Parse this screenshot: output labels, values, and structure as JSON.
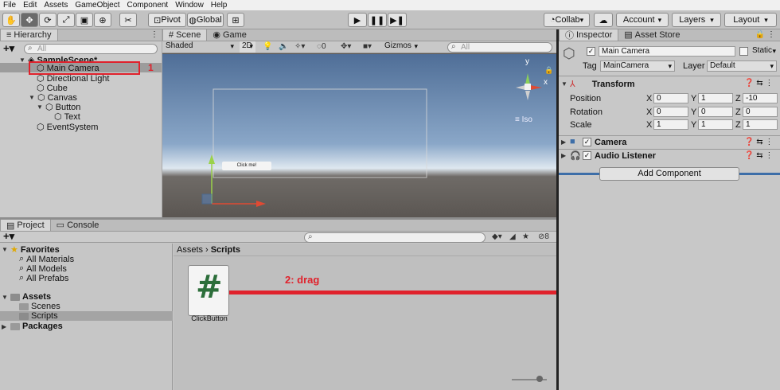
{
  "menu": [
    "File",
    "Edit",
    "Assets",
    "GameObject",
    "Component",
    "Window",
    "Help"
  ],
  "toolbar": {
    "pivot": "Pivot",
    "global": "Global",
    "collab": "Collab",
    "account": "Account",
    "layers": "Layers",
    "layout": "Layout"
  },
  "hierarchy": {
    "tab": "Hierarchy",
    "search_placeholder": "All",
    "scene": "SampleScene*",
    "items": [
      "Main Camera",
      "Directional Light",
      "Cube",
      "Canvas",
      "Button",
      "Text",
      "EventSystem"
    ]
  },
  "scene_view": {
    "tabs": [
      "Scene",
      "Game"
    ],
    "shading": "Shaded",
    "mode_2d": "2D",
    "gizmos": "Gizmos",
    "search_placeholder": "All",
    "gizmo_y": "y",
    "gizmo_x": "x",
    "iso": "Iso",
    "button_text": "Click me!"
  },
  "project": {
    "tabs": [
      "Project",
      "Console"
    ],
    "badge": "8",
    "favorites": "Favorites",
    "fav_items": [
      "All Materials",
      "All Models",
      "All Prefabs"
    ],
    "assets": "Assets",
    "asset_items": [
      "Scenes",
      "Scripts"
    ],
    "packages": "Packages",
    "breadcrumb": [
      "Assets",
      "Scripts"
    ],
    "file_name": "ClickButton",
    "file_glyph": "#"
  },
  "inspector": {
    "tabs": [
      "Inspector",
      "Asset Store"
    ],
    "object_name": "Main Camera",
    "static": "Static",
    "tag_label": "Tag",
    "tag_value": "MainCamera",
    "layer_label": "Layer",
    "layer_value": "Default",
    "transform": "Transform",
    "position_label": "Position",
    "position": [
      "0",
      "1",
      "-10"
    ],
    "rotation_label": "Rotation",
    "rotation": [
      "0",
      "0",
      "0"
    ],
    "scale_label": "Scale",
    "scale": [
      "1",
      "1",
      "1"
    ],
    "axes": [
      "X",
      "Y",
      "Z"
    ],
    "camera": "Camera",
    "audio": "Audio Listener",
    "add_component": "Add Component"
  },
  "annotations": {
    "step1": "1",
    "step2": "2: drag"
  },
  "colors": {
    "annotation": "#e0212b",
    "selection": "#3d6ea8",
    "sky_top": "#4f6e97",
    "ground": "#5b5652"
  }
}
